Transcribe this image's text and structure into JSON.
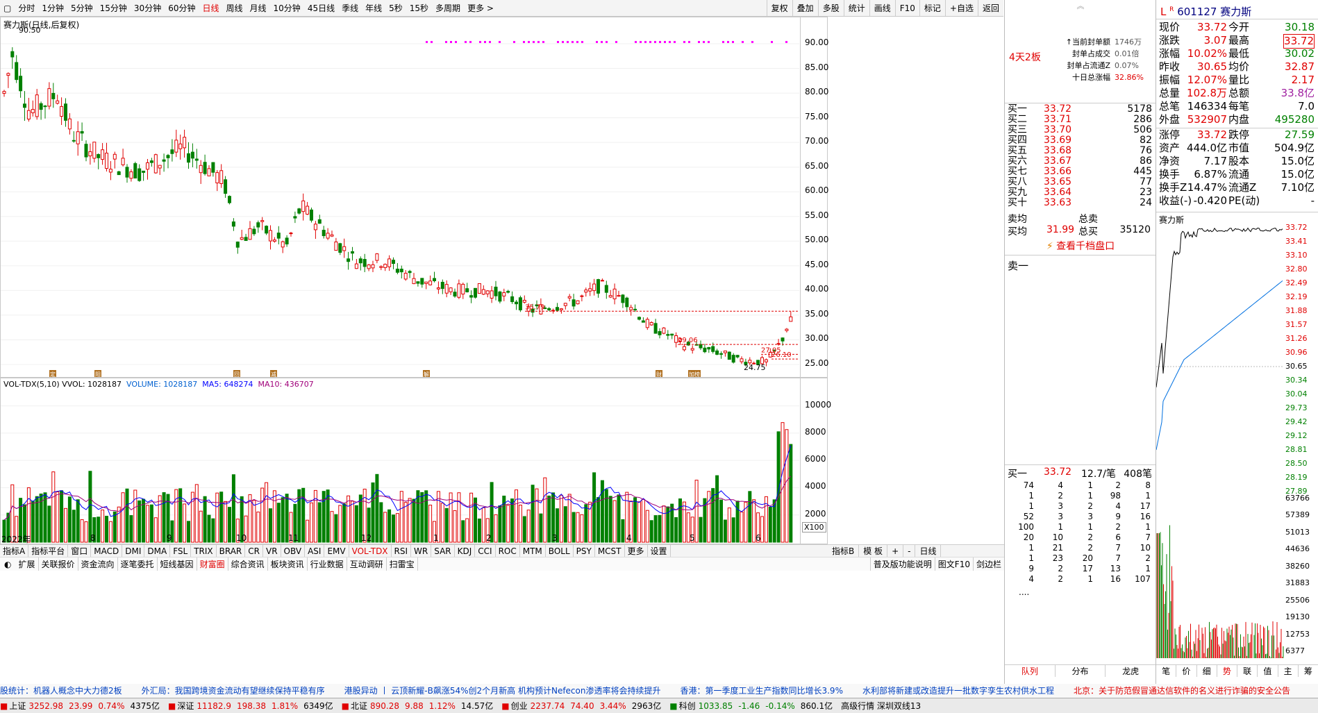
{
  "toolbar": {
    "periods": [
      "分时",
      "1分钟",
      "5分钟",
      "15分钟",
      "30分钟",
      "60分钟",
      "日线",
      "周线",
      "月线",
      "10分钟",
      "45日线",
      "季线",
      "年线",
      "5秒",
      "15秒",
      "多周期",
      "更多 >"
    ],
    "active": "日线",
    "right": [
      "复权",
      "叠加",
      "多股",
      "统计",
      "画线",
      "F10",
      "标记",
      "+自选",
      "返回"
    ]
  },
  "chart": {
    "stock_title": "赛力斯(日线,后复权)",
    "hi_label": "90.50",
    "lo_label": "24.75",
    "price_axis": [
      "90.00",
      "85.00",
      "80.00",
      "75.00",
      "70.00",
      "65.00",
      "60.00",
      "55.00",
      "50.00",
      "45.00",
      "40.00",
      "35.00",
      "30.00",
      "25.00"
    ],
    "markers": [
      {
        "t": "35.79"
      },
      {
        "t": "29.06"
      },
      {
        "t": "27.05"
      },
      {
        "t": "26.10"
      }
    ],
    "event_icons": [
      "定",
      "阳",
      "回",
      "减",
      "解",
      "财",
      "加榜"
    ]
  },
  "volume": {
    "header": "VOL-TDX(5,10)  VVOL: 1028187",
    "vol_label": "VOLUME: 1028187",
    "ma5_label": "MA5: 648274",
    "ma10_label": "MA10: 436707",
    "axis": [
      "10000",
      "8000",
      "6000",
      "4000",
      "2000"
    ],
    "unit": "X100",
    "months": [
      "2022年",
      "8",
      "9",
      "10",
      "11",
      "12",
      "1",
      "2",
      "3",
      "4",
      "5",
      "6"
    ]
  },
  "chart_data": {
    "type": "candlestick",
    "title": "赛力斯(日线,后复权)",
    "y_axis": [
      25,
      90
    ],
    "high": 90.5,
    "low": 24.75,
    "last_close": 33.72,
    "ref_lines": [
      35.79,
      29.06,
      27.05,
      26.1
    ],
    "volume_axis": [
      0,
      10000
    ]
  },
  "indicator_tabs": [
    "指标A",
    "指标平台",
    "窗口",
    "MACD",
    "DMI",
    "DMA",
    "FSL",
    "TRIX",
    "BRAR",
    "CR",
    "VR",
    "OBV",
    "ASI",
    "EMV",
    "VOL-TDX",
    "RSI",
    "WR",
    "SAR",
    "KDJ",
    "CCI",
    "ROC",
    "MTM",
    "BOLL",
    "PSY",
    "MCST",
    "更多",
    "设置"
  ],
  "indicator_tabs_right": [
    "指标B",
    "模 板",
    "+",
    "-",
    "日线"
  ],
  "bottom_tabs": [
    "扩展",
    "关联报价",
    "资金流向",
    "逐笔委托",
    "短线基因",
    "财富圈",
    "综合资讯",
    "板块资讯",
    "行业数据",
    "互动调研",
    "扫雷宝"
  ],
  "bottom_right": [
    "普及版功能说明",
    "图文F10",
    "剑边栏"
  ],
  "board": {
    "tag": "4天2板",
    "rows": [
      {
        "k": "↑当前封单额",
        "v": "1746万"
      },
      {
        "k": "封单占成交",
        "v": "0.01倍"
      },
      {
        "k": "封单占流通Z",
        "v": "0.07%"
      },
      {
        "k": "十日总涨幅",
        "v": "32.86%"
      }
    ]
  },
  "bids": [
    {
      "n": "买一",
      "p": "33.72",
      "v": "5178"
    },
    {
      "n": "买二",
      "p": "33.71",
      "v": "286"
    },
    {
      "n": "买三",
      "p": "33.70",
      "v": "506"
    },
    {
      "n": "买四",
      "p": "33.69",
      "v": "82"
    },
    {
      "n": "买五",
      "p": "33.68",
      "v": "76"
    },
    {
      "n": "买六",
      "p": "33.67",
      "v": "86"
    },
    {
      "n": "买七",
      "p": "33.66",
      "v": "445"
    },
    {
      "n": "买八",
      "p": "33.65",
      "v": "77"
    },
    {
      "n": "买九",
      "p": "33.64",
      "v": "23"
    },
    {
      "n": "买十",
      "p": "33.63",
      "v": "24"
    }
  ],
  "avg": {
    "sell_label": "卖均",
    "sell_total": "总卖",
    "buy_label": "买均",
    "buy_avg": "31.99",
    "buy_total_label": "总买",
    "buy_total": "35120",
    "more": "查看千档盘口",
    "sell1": "卖一"
  },
  "queue": {
    "head": "买一",
    "price": "33.72",
    "per": "12.7/笔",
    "count": "408笔",
    "rows": [
      [
        "74",
        "4",
        "1",
        "2",
        "8"
      ],
      [
        "1",
        "2",
        "1",
        "98",
        "1"
      ],
      [
        "1",
        "3",
        "2",
        "4",
        "17"
      ],
      [
        "52",
        "3",
        "3",
        "9",
        "16"
      ],
      [
        "100",
        "1",
        "1",
        "2",
        "1"
      ],
      [
        "20",
        "10",
        "2",
        "6",
        "7"
      ],
      [
        "1",
        "21",
        "2",
        "7",
        "10"
      ],
      [
        "1",
        "23",
        "20",
        "7",
        "2"
      ],
      [
        "9",
        "2",
        "17",
        "13",
        "1"
      ],
      [
        "4",
        "2",
        "1",
        "16",
        "107"
      ]
    ],
    "more": "...."
  },
  "blk_tabs": [
    "队列",
    "分布",
    "龙虎"
  ],
  "quote": {
    "code": "601127",
    "name": "赛力斯",
    "rows": [
      {
        "a": "现价",
        "av": "33.72",
        "b": "今开",
        "bv": "30.18"
      },
      {
        "a": "涨跌",
        "av": "3.07",
        "b": "最高",
        "bv": "33.72"
      },
      {
        "a": "涨幅",
        "av": "10.02%",
        "b": "最低",
        "bv": "30.02"
      },
      {
        "a": "昨收",
        "av": "30.65",
        "b": "均价",
        "bv": "32.87"
      },
      {
        "a": "振幅",
        "av": "12.07%",
        "b": "量比",
        "bv": "2.17"
      },
      {
        "a": "总量",
        "av": "102.8万",
        "b": "总额",
        "bv": "33.8亿"
      },
      {
        "a": "总笔",
        "av": "146334",
        "b": "每笔",
        "bv": "7.0"
      },
      {
        "a": "外盘",
        "av": "532907",
        "b": "内盘",
        "bv": "495280"
      }
    ],
    "rows2": [
      {
        "a": "涨停",
        "av": "33.72",
        "b": "跌停",
        "bv": "27.59"
      },
      {
        "a": "资产",
        "av": "444.0亿",
        "b": "市值",
        "bv": "504.9亿"
      },
      {
        "a": "净资",
        "av": "7.17",
        "b": "股本",
        "bv": "15.0亿"
      },
      {
        "a": "换手",
        "av": "6.87%",
        "b": "流通",
        "bv": "15.0亿"
      },
      {
        "a": "换手Z",
        "av": "14.47%",
        "b": "流通Z",
        "bv": "7.10亿"
      },
      {
        "a": "收益(-)",
        "av": "-0.420",
        "b": "PE(动)",
        "bv": "-"
      }
    ],
    "mini_title": "赛力斯",
    "mini_axis": [
      "33.72",
      "33.41",
      "33.10",
      "32.80",
      "32.49",
      "32.19",
      "31.88",
      "31.57",
      "31.26",
      "30.96",
      "30.65",
      "30.34",
      "30.04",
      "29.73",
      "29.42",
      "29.12",
      "28.81",
      "28.50",
      "28.19",
      "27.89",
      "63766",
      "57389",
      "51013",
      "44636",
      "38260",
      "31883",
      "25506",
      "19130",
      "12753",
      "6377"
    ],
    "tabs": [
      "笔",
      "价",
      "细",
      "势",
      "联",
      "值",
      "主",
      "筹"
    ]
  },
  "news": [
    "股统计：机器人概念中大力德2板",
    "外汇局：我国跨境资金流动有望继续保持平稳有序",
    "港股异动 丨 云顶新耀-B飙涨54%创2个月新高 机构预计Nefecon渗透率将会持续提升",
    "香港：第一季度工业生产指数同比增长3.9%",
    "水利部将新建或改造提升一批数字孪生农村供水工程",
    "北京：关于防范假冒通达信软件的名义进行诈骗的安全公告"
  ],
  "status": {
    "items": [
      {
        "n": "上证",
        "v": "3252.98",
        "c": "23.99",
        "p": "0.74%",
        "a": "4375亿"
      },
      {
        "n": "深证",
        "v": "11182.9",
        "c": "198.38",
        "p": "1.81%",
        "a": "6349亿"
      },
      {
        "n": "北证",
        "v": "890.28",
        "c": "9.88",
        "p": "1.12%",
        "a": "14.57亿"
      },
      {
        "n": "创业",
        "v": "2237.74",
        "c": "74.40",
        "p": "3.44%",
        "a": "2963亿"
      },
      {
        "n": "科创",
        "v": "1033.85",
        "c": "-1.46",
        "p": "-0.14%",
        "a": "860.1亿"
      }
    ],
    "right": "高级行情  深圳双线13"
  },
  "colors": {
    "up": "#e00000",
    "down": "#008000",
    "ma5": "#0000ff",
    "ma10": "#a0007a"
  }
}
